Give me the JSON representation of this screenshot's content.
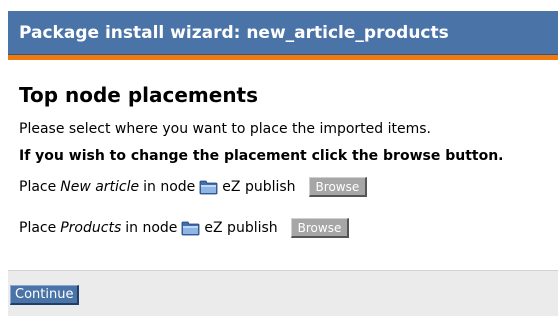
{
  "window": {
    "title": "Package install wizard: new_article_products"
  },
  "main": {
    "heading": "Top node placements",
    "instruction": "Please select where you want to place the imported items.",
    "note": "If you wish to change the placement click the browse button.",
    "placements": [
      {
        "prefix": "Place",
        "item": "New article",
        "in_node": "in node",
        "node_icon": "folder-icon",
        "node_name": "eZ publish",
        "browse_label": "Browse"
      },
      {
        "prefix": "Place",
        "item": "Products",
        "in_node": "in node",
        "node_icon": "folder-icon",
        "node_name": "eZ publish",
        "browse_label": "Browse"
      }
    ]
  },
  "footer": {
    "continue_label": "Continue"
  },
  "colors": {
    "title_bar": "#4a74a8",
    "accent": "#f07a0e",
    "button_grey": "#a6a6a6",
    "footer_bg": "#ebebeb"
  }
}
